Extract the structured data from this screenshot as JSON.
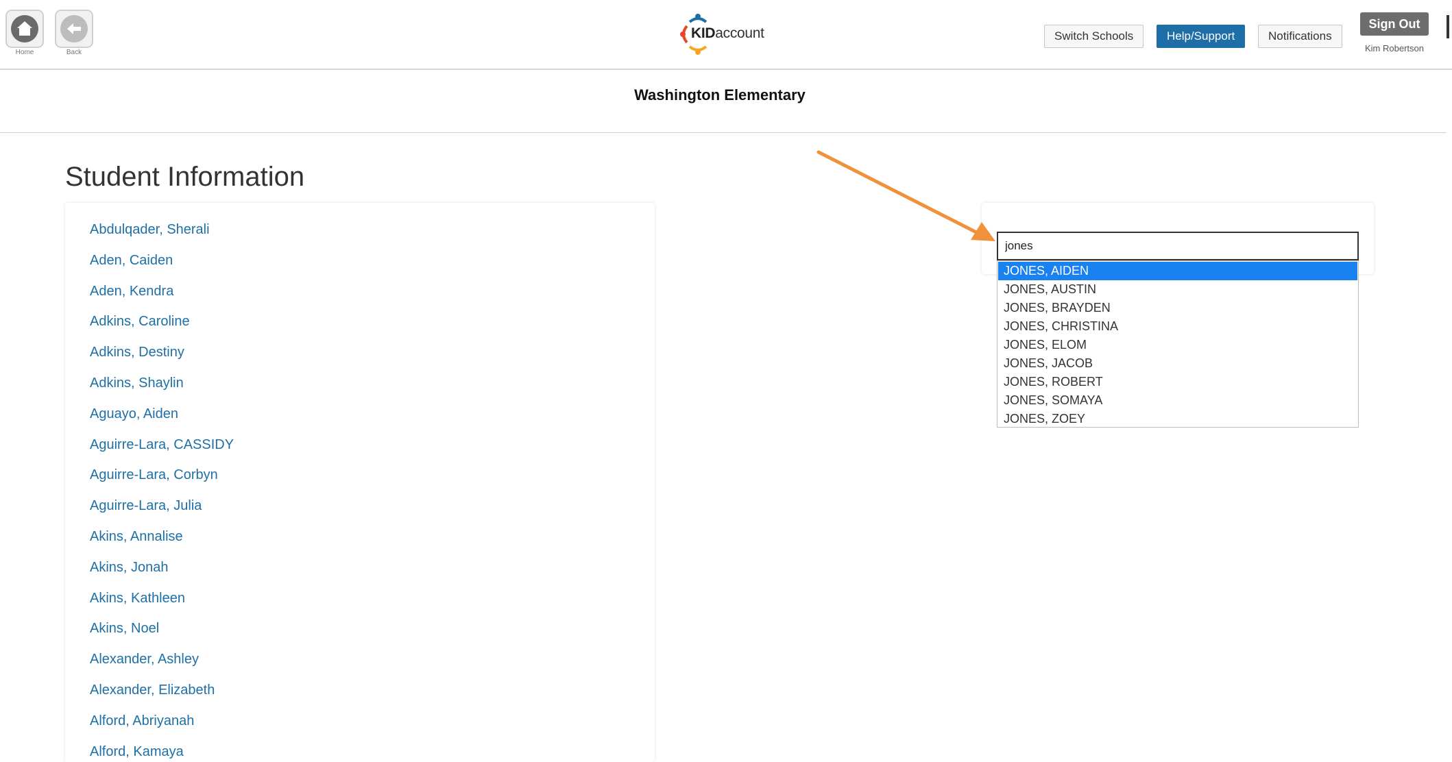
{
  "nav": {
    "home_label": "Home",
    "back_label": "Back"
  },
  "logo": {
    "kid": "KID",
    "account": "account"
  },
  "header": {
    "switch_schools": "Switch Schools",
    "help_support": "Help/Support",
    "notifications": "Notifications",
    "sign_out": "Sign Out",
    "user_name": "Kim Robertson"
  },
  "school": {
    "name": "Washington Elementary"
  },
  "page": {
    "title": "Student Information"
  },
  "students": [
    "Abdulqader, Sherali",
    "Aden, Caiden",
    "Aden, Kendra",
    "Adkins, Caroline",
    "Adkins, Destiny",
    "Adkins, Shaylin",
    "Aguayo, Aiden",
    "Aguirre-Lara, CASSIDY",
    "Aguirre-Lara, Corbyn",
    "Aguirre-Lara, Julia",
    "Akins, Annalise",
    "Akins, Jonah",
    "Akins, Kathleen",
    "Akins, Noel",
    "Alexander, Ashley",
    "Alexander, Elizabeth",
    "Alford, Abriyanah",
    "Alford, Kamaya"
  ],
  "search": {
    "value": "jones",
    "selected_index": 0,
    "results": [
      "JONES, AIDEN",
      "JONES, AUSTIN",
      "JONES, BRAYDEN",
      "JONES, CHRISTINA",
      "JONES, ELOM",
      "JONES, JACOB",
      "JONES, ROBERT",
      "JONES, SOMAYA",
      "JONES, ZOEY"
    ]
  },
  "colors": {
    "link": "#1d6fa6",
    "primary_button": "#1e6ea7",
    "selected_option": "#1a82f0",
    "annotation_arrow": "#f0923b",
    "sign_out": "#6d6d6d"
  }
}
